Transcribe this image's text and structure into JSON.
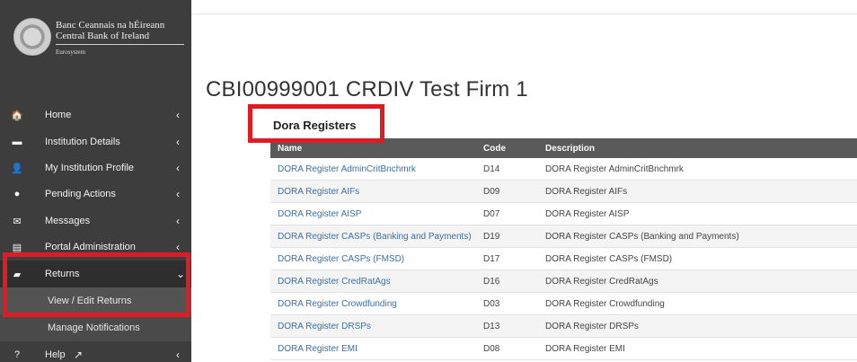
{
  "brand": {
    "line1": "Banc Ceannais na hÉireann",
    "line2": "Central Bank of Ireland",
    "line3": "Eurosystem"
  },
  "nav": [
    {
      "icon": "home-icon",
      "glyph": "🏠",
      "label": "Home",
      "chevron": "‹"
    },
    {
      "icon": "institution-icon",
      "glyph": "▬",
      "label": "Institution Details",
      "chevron": "‹"
    },
    {
      "icon": "user-icon",
      "glyph": "👤",
      "label": "My Institution Profile",
      "chevron": "‹"
    },
    {
      "icon": "info-icon",
      "glyph": "●",
      "label": "Pending Actions",
      "chevron": "‹"
    },
    {
      "icon": "envelope-icon",
      "glyph": "✉",
      "label": "Messages",
      "chevron": "‹"
    },
    {
      "icon": "admin-icon",
      "glyph": "▤",
      "label": "Portal Administration",
      "chevron": "‹"
    },
    {
      "icon": "folder-icon",
      "glyph": "▰",
      "label": "Returns",
      "chevron": "⌄"
    },
    {
      "icon": "help-icon",
      "glyph": "?",
      "label": "Help",
      "chevron": "‹"
    }
  ],
  "returns_sub": [
    {
      "label": "View / Edit Returns"
    },
    {
      "label": "Manage Notifications"
    }
  ],
  "help_external_glyph": "↗",
  "page_title": "CBI00999001 CRDIV Test Firm 1",
  "section_title": "Dora Registers",
  "table": {
    "headers": [
      "Name",
      "Code",
      "Description"
    ],
    "rows": [
      {
        "name": "DORA Register AdminCritBnchmrk",
        "code": "D14",
        "description": "DORA Register AdminCritBnchmrk"
      },
      {
        "name": "DORA Register AIFs",
        "code": "D09",
        "description": "DORA Register AIFs"
      },
      {
        "name": "DORA Register AISP",
        "code": "D07",
        "description": "DORA Register AISP"
      },
      {
        "name": "DORA Register CASPs (Banking and Payments)",
        "code": "D19",
        "description": "DORA Register CASPs (Banking and Payments)"
      },
      {
        "name": "DORA Register CASPs (FMSD)",
        "code": "D17",
        "description": "DORA Register CASPs (FMSD)"
      },
      {
        "name": "DORA Register CredRatAgs",
        "code": "D16",
        "description": "DORA Register CredRatAgs"
      },
      {
        "name": "DORA Register Crowdfunding",
        "code": "D03",
        "description": "DORA Register Crowdfunding"
      },
      {
        "name": "DORA Register DRSPs",
        "code": "D13",
        "description": "DORA Register DRSPs"
      },
      {
        "name": "DORA Register EMI",
        "code": "D08",
        "description": "DORA Register EMI"
      }
    ]
  },
  "highlight_color": "#e01b24"
}
